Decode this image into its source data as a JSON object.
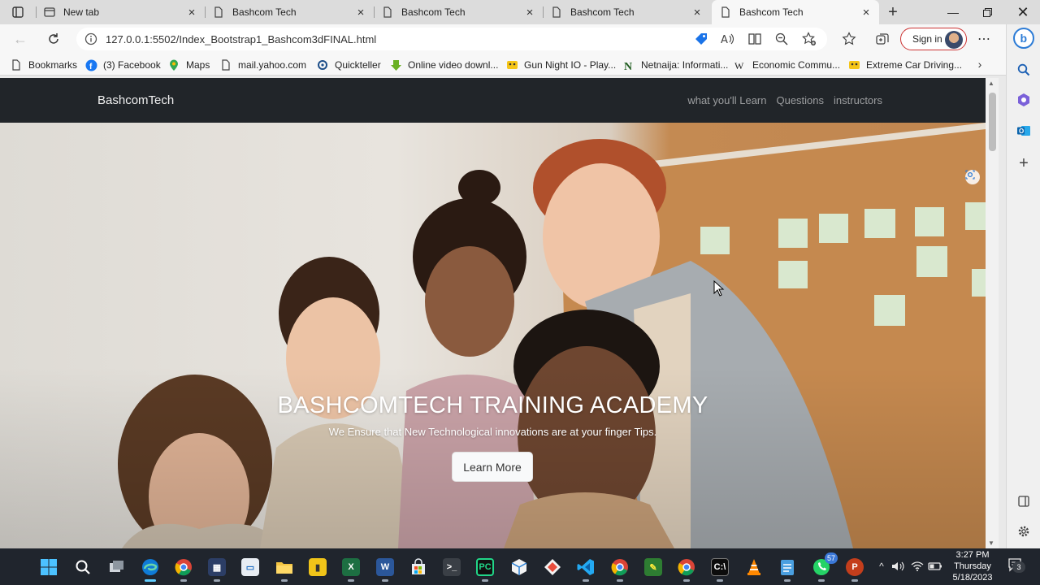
{
  "browser": {
    "tabs": [
      {
        "title": "New tab",
        "active": false
      },
      {
        "title": "Bashcom Tech",
        "active": false
      },
      {
        "title": "Bashcom Tech",
        "active": false
      },
      {
        "title": "Bashcom Tech",
        "active": false
      },
      {
        "title": "Bashcom Tech",
        "active": true
      }
    ],
    "address": {
      "url": "127.0.0.1:5502/Index_Bootstrap1_Bashcom3dFINAL.html"
    },
    "sign_in_label": "Sign in",
    "bookmarks": [
      {
        "label": "Bookmarks",
        "icon": "folder-icon"
      },
      {
        "label": "(3) Facebook",
        "icon": "facebook-icon"
      },
      {
        "label": "Maps",
        "icon": "maps-pin-icon"
      },
      {
        "label": "mail.yahoo.com",
        "icon": "page-icon"
      },
      {
        "label": "Quickteller",
        "icon": "quickteller-icon"
      },
      {
        "label": "Online video downl...",
        "icon": "download-arrow-icon"
      },
      {
        "label": "Gun Night IO - Play...",
        "icon": "game-icon"
      },
      {
        "label": "Netnaija: Informati...",
        "icon": "netnaija-n-icon"
      },
      {
        "label": "Economic Commu...",
        "icon": "wikipedia-w-icon"
      },
      {
        "label": "Extreme Car Driving...",
        "icon": "game-icon"
      }
    ]
  },
  "site": {
    "brand": "BashcomTech",
    "nav": [
      {
        "label": "what you'll Learn"
      },
      {
        "label": "Questions"
      },
      {
        "label": "instructors"
      }
    ],
    "hero": {
      "title": "BASHCOMTECH TRAINING ACADEMY",
      "subtitle": "We Ensure that New Technological innovations are at your finger Tips.",
      "button_label": "Learn More"
    }
  },
  "taskbar": {
    "clock": {
      "time": "3:27 PM",
      "day": "Thursday",
      "date": "5/18/2023"
    },
    "whatsapp_badge": "57",
    "notification_badge": "3"
  },
  "colors": {
    "navbar_bg": "#212529",
    "accent_edge": "#0a84d6",
    "signin_border": "#cc3333"
  }
}
